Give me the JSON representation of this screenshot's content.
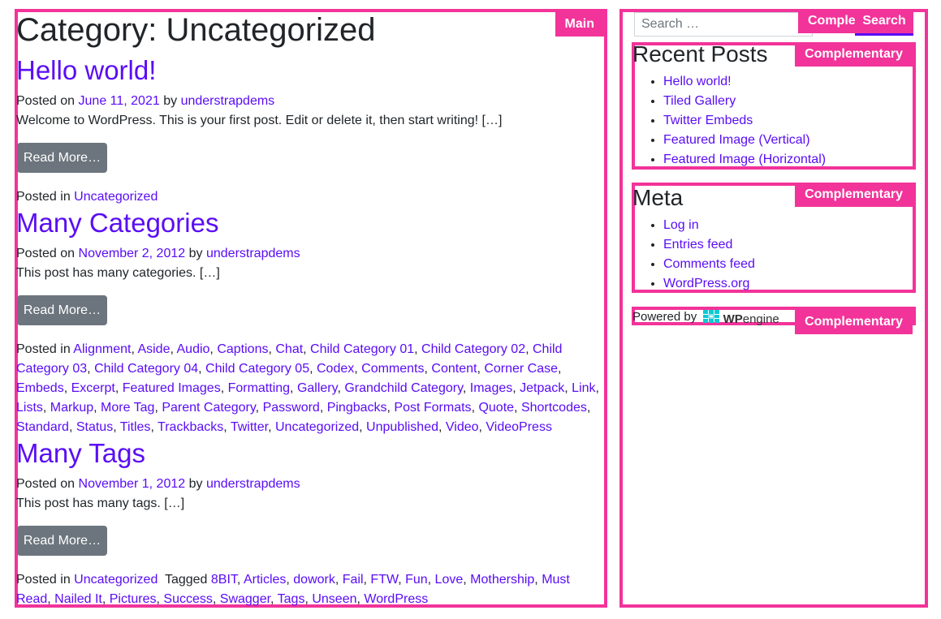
{
  "main": {
    "badge": "Main",
    "page_title": "Category: Uncategorized",
    "posts": [
      {
        "title": "Hello world!",
        "posted_on_prefix": "Posted on",
        "date": "June 11, 2021",
        "by": "by",
        "author": "understrapdems",
        "excerpt": "Welcome to WordPress. This is your first post. Edit or delete it, then start writing! […]",
        "read_more": "Read More…",
        "posted_in_prefix": "Posted in",
        "categories": [
          "Uncategorized"
        ]
      },
      {
        "title": "Many Categories",
        "posted_on_prefix": "Posted on",
        "date": "November 2, 2012",
        "by": "by",
        "author": "understrapdems",
        "excerpt": "This post has many categories. […]",
        "read_more": "Read More…",
        "posted_in_prefix": "Posted in",
        "categories": [
          "Alignment",
          "Aside",
          "Audio",
          "Captions",
          "Chat",
          "Child Category 01",
          "Child Category 02",
          "Child Category 03",
          "Child Category 04",
          "Child Category 05",
          "Codex",
          "Comments",
          "Content",
          "Corner Case",
          "Embeds",
          "Excerpt",
          "Featured Images",
          "Formatting",
          "Gallery",
          "Grandchild Category",
          "Images",
          "Jetpack",
          "Link",
          "Lists",
          "Markup",
          "More Tag",
          "Parent Category",
          "Password",
          "Pingbacks",
          "Post Formats",
          "Quote",
          "Shortcodes",
          "Standard",
          "Status",
          "Titles",
          "Trackbacks",
          "Twitter",
          "Uncategorized",
          "Unpublished",
          "Video",
          "VideoPress"
        ]
      },
      {
        "title": "Many Tags",
        "posted_on_prefix": "Posted on",
        "date": "November 1, 2012",
        "by": "by",
        "author": "understrapdems",
        "excerpt": "This post has many tags. […]",
        "read_more": "Read More…",
        "posted_in_prefix": "Posted in",
        "categories": [
          "Uncategorized"
        ],
        "tagged_prefix": "Tagged",
        "tags": [
          "8BIT",
          "Articles",
          "dowork",
          "Fail",
          "FTW",
          "Fun",
          "Love",
          "Mothership",
          "Must Read",
          "Nailed It",
          "Pictures",
          "Success",
          "Swagger",
          "Tags",
          "Unseen",
          "WordPress"
        ]
      }
    ]
  },
  "sidebar": {
    "search": {
      "placeholder": "Search …",
      "badge": "Comple",
      "button_label": "Search"
    },
    "recent_posts": {
      "badge": "Complementary",
      "title": "Recent Posts",
      "items": [
        "Hello world!",
        "Tiled Gallery",
        "Twitter Embeds",
        "Featured Image (Vertical)",
        "Featured Image (Horizontal)"
      ]
    },
    "meta": {
      "badge": "Complementary",
      "title": "Meta",
      "items": [
        "Log in",
        "Entries feed",
        "Comments feed",
        "WordPress.org"
      ]
    },
    "powered": {
      "badge": "Complementary",
      "text": "Powered by",
      "logo_bold": "WP",
      "logo_rest": "engine"
    }
  },
  "colors": {
    "annotation": "#f2339a",
    "link": "#5a0df5",
    "button": "#6c757d",
    "text": "#212529"
  }
}
